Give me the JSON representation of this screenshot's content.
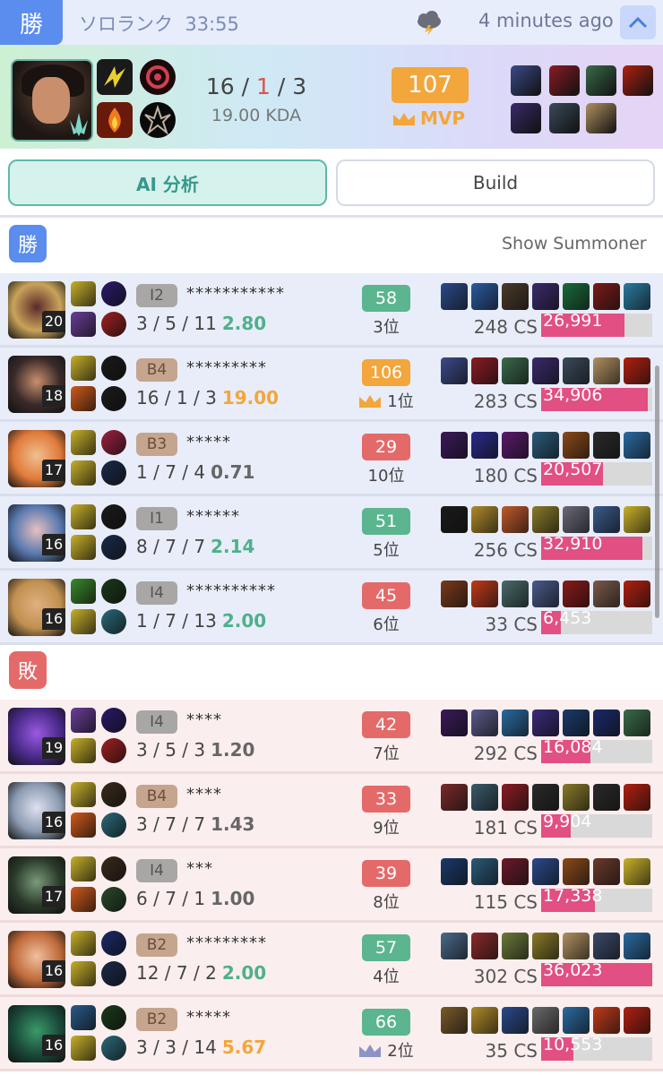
{
  "header": {
    "result_badge": "勝",
    "queue": "ソロランク",
    "duration": "33:55",
    "ago": "4 minutes ago"
  },
  "summary": {
    "kills": "16",
    "deaths": "1",
    "assists": "3",
    "kda": "19.00 KDA",
    "score": "107",
    "mvp_label": "MVP",
    "items": [
      "#3b4a8a",
      "#8a1c24",
      "#3a6a4a",
      "#b02010",
      "#3a2a6a",
      "#3a4a5a",
      "#b09060"
    ]
  },
  "tabs": {
    "ai": "AI 分析",
    "build": "Build"
  },
  "teams": {
    "win_label": "勝",
    "loss_label": "敗",
    "show_summoner": "Show Summoner"
  },
  "colors": {
    "green": "#4fb08b",
    "orange": "#f2a63b",
    "red": "#e46a6a",
    "gray": "#666666",
    "crown": "#8c94c6"
  },
  "win_players": [
    {
      "level": "20",
      "rank": "I2",
      "rank_tier": "iron",
      "name": "***********",
      "k": "3",
      "d": "5",
      "a": "11",
      "ratio": "2.80",
      "ratio_color": "green",
      "score": "58",
      "score_color": "green",
      "pos": "3位",
      "crown": false,
      "cs": "248 CS",
      "dmg": "26,991",
      "dmg_frac": 0.75,
      "champ": [
        "#c9a35a",
        "#5a2a2a"
      ],
      "spells": [
        "#c8b12a",
        "#6a3e9a"
      ],
      "runes": [
        "#2a1a6a",
        "#a02020"
      ],
      "items": [
        "#2a4a8a",
        "#2a5aa0",
        "#4a3a2a",
        "#3a2a6a",
        "#1a6a3a",
        "#7a1a1a",
        "#2a7aa0"
      ]
    },
    {
      "level": "18",
      "rank": "B4",
      "rank_tier": "bronze",
      "name": "*********",
      "k": "16",
      "d": "1",
      "a": "3",
      "ratio": "19.00",
      "ratio_color": "orange",
      "score": "106",
      "score_color": "orange",
      "pos": "1位",
      "crown": true,
      "cs": "283 CS",
      "dmg": "34,906",
      "dmg_frac": 0.96,
      "champ": [
        "#3a2a2a",
        "#c98f6c"
      ],
      "spells": [
        "#c8b12a",
        "#d05a1a"
      ],
      "runes": [
        "#1a1a1a",
        "#1a1a1a"
      ],
      "items": [
        "#3b4a8a",
        "#8a1c24",
        "#3a6a4a",
        "#3a2a6a",
        "#3a4a5a",
        "#b09060",
        "#b02010"
      ]
    },
    {
      "level": "17",
      "rank": "B3",
      "rank_tier": "bronze",
      "name": "*****",
      "k": "1",
      "d": "7",
      "a": "4",
      "ratio": "0.71",
      "ratio_color": "gray",
      "score": "29",
      "score_color": "red",
      "pos": "10位",
      "crown": false,
      "cs": "180 CS",
      "dmg": "20,507",
      "dmg_frac": 0.56,
      "champ": [
        "#e07a3a",
        "#f0c090"
      ],
      "spells": [
        "#c8b12a",
        "#c8b12a"
      ],
      "runes": [
        "#a02040",
        "#1a2a4a"
      ],
      "items": [
        "#3a1a5a",
        "#2a2a8a",
        "#5a1a6a",
        "#2a5a7a",
        "#8a4a1a",
        "#2a2a2a",
        "#2a6aa0"
      ]
    },
    {
      "level": "16",
      "rank": "I1",
      "rank_tier": "iron",
      "name": "******",
      "k": "8",
      "d": "7",
      "a": "7",
      "ratio": "2.14",
      "ratio_color": "green",
      "score": "51",
      "score_color": "green",
      "pos": "5位",
      "crown": false,
      "cs": "256 CS",
      "dmg": "32,910",
      "dmg_frac": 0.91,
      "champ": [
        "#5a7ab0",
        "#e8c0c0"
      ],
      "spells": [
        "#c8b12a",
        "#c8b12a"
      ],
      "runes": [
        "#1a1a1a",
        "#1a2a4a"
      ],
      "items": [
        "#1a1a1a",
        "#b08a2a",
        "#c05a2a",
        "#8a7a2a",
        "#6a6a7a",
        "#3a5a8a",
        "#c8b12a"
      ]
    },
    {
      "level": "16",
      "rank": "I4",
      "rank_tier": "iron",
      "name": "**********",
      "k": "1",
      "d": "7",
      "a": "13",
      "ratio": "2.00",
      "ratio_color": "green",
      "score": "45",
      "score_color": "red",
      "pos": "6位",
      "crown": false,
      "cs": "33 CS",
      "dmg": "6,453",
      "dmg_frac": 0.18,
      "champ": [
        "#c09050",
        "#e0b080"
      ],
      "spells": [
        "#3a8a2a",
        "#c8b12a"
      ],
      "runes": [
        "#1a3a1a",
        "#2a6a7a"
      ],
      "items": [
        "#7a3a1a",
        "#c03a1a",
        "#4a6a6a",
        "#4a5a8a",
        "#8a1a1a",
        "#7a5a4a",
        "#b02010"
      ]
    }
  ],
  "loss_players": [
    {
      "level": "19",
      "rank": "I4",
      "rank_tier": "iron",
      "name": "****",
      "k": "3",
      "d": "5",
      "a": "3",
      "ratio": "1.20",
      "ratio_color": "gray",
      "score": "42",
      "score_color": "red",
      "pos": "7位",
      "crown": false,
      "cs": "292 CS",
      "dmg": "16,084",
      "dmg_frac": 0.44,
      "champ": [
        "#4a2a8a",
        "#9a5ae0"
      ],
      "spells": [
        "#6a3e9a",
        "#c8b12a"
      ],
      "runes": [
        "#2a1a6a",
        "#a02020"
      ],
      "items": [
        "#3a1a5a",
        "#5a5a8a",
        "#2a6aa0",
        "#3a2a7a",
        "#1a3a6a",
        "#1a2a6a",
        "#3a6a4a"
      ]
    },
    {
      "level": "16",
      "rank": "B4",
      "rank_tier": "bronze",
      "name": "****",
      "k": "3",
      "d": "7",
      "a": "7",
      "ratio": "1.43",
      "ratio_color": "gray",
      "score": "33",
      "score_color": "red",
      "pos": "9位",
      "crown": false,
      "cs": "181 CS",
      "dmg": "9,904",
      "dmg_frac": 0.27,
      "champ": [
        "#8a9ab0",
        "#e0e0f0"
      ],
      "spells": [
        "#c8b12a",
        "#d05a1a"
      ],
      "runes": [
        "#3a2a1a",
        "#2a6a7a"
      ],
      "items": [
        "#7a2a2a",
        "#3a5a6a",
        "#8a1c24",
        "#2a2a2a",
        "#8a7a2a",
        "#2a2a2a",
        "#b02010"
      ]
    },
    {
      "level": "17",
      "rank": "I4",
      "rank_tier": "iron",
      "name": "***",
      "k": "6",
      "d": "7",
      "a": "1",
      "ratio": "1.00",
      "ratio_color": "gray",
      "score": "39",
      "score_color": "red",
      "pos": "8位",
      "crown": false,
      "cs": "115 CS",
      "dmg": "17,338",
      "dmg_frac": 0.48,
      "champ": [
        "#2a3a2a",
        "#7a9a7a"
      ],
      "spells": [
        "#c8b12a",
        "#d05a1a"
      ],
      "runes": [
        "#3a2a1a",
        "#2a4a2a"
      ],
      "items": [
        "#1a3a6a",
        "#2a5a7a",
        "#6a1a2a",
        "#2a4a8a",
        "#8a4a1a",
        "#6a3a2a",
        "#c8b12a"
      ]
    },
    {
      "level": "16",
      "rank": "B2",
      "rank_tier": "bronze",
      "name": "*********",
      "k": "12",
      "d": "7",
      "a": "2",
      "ratio": "2.00",
      "ratio_color": "green",
      "score": "57",
      "score_color": "green",
      "pos": "4位",
      "crown": false,
      "cs": "302 CS",
      "dmg": "36,023",
      "dmg_frac": 1.0,
      "champ": [
        "#c06a3a",
        "#f0c0a0"
      ],
      "spells": [
        "#c8b12a",
        "#c8b12a"
      ],
      "runes": [
        "#1a2a6a",
        "#1a2a4a"
      ],
      "items": [
        "#4a6a8a",
        "#8a2a2a",
        "#6a7a3a",
        "#8a7a2a",
        "#b09060",
        "#3a4a6a",
        "#2a6aa0"
      ]
    },
    {
      "level": "16",
      "rank": "B2",
      "rank_tier": "bronze",
      "name": "*****",
      "k": "3",
      "d": "3",
      "a": "14",
      "ratio": "5.67",
      "ratio_color": "orange",
      "score": "66",
      "score_color": "green",
      "pos": "2位",
      "crown": true,
      "cs": "35 CS",
      "dmg": "10,553",
      "dmg_frac": 0.29,
      "champ": [
        "#1a4a3a",
        "#3a9a6a"
      ],
      "spells": [
        "#2a5a8a",
        "#c8b12a"
      ],
      "runes": [
        "#1a3a1a",
        "#2a6a7a"
      ],
      "items": [
        "#7a5a2a",
        "#b08a2a",
        "#2a4a8a",
        "#6a6a6a",
        "#2a6aa0",
        "#c03a1a",
        "#b02010"
      ]
    }
  ]
}
